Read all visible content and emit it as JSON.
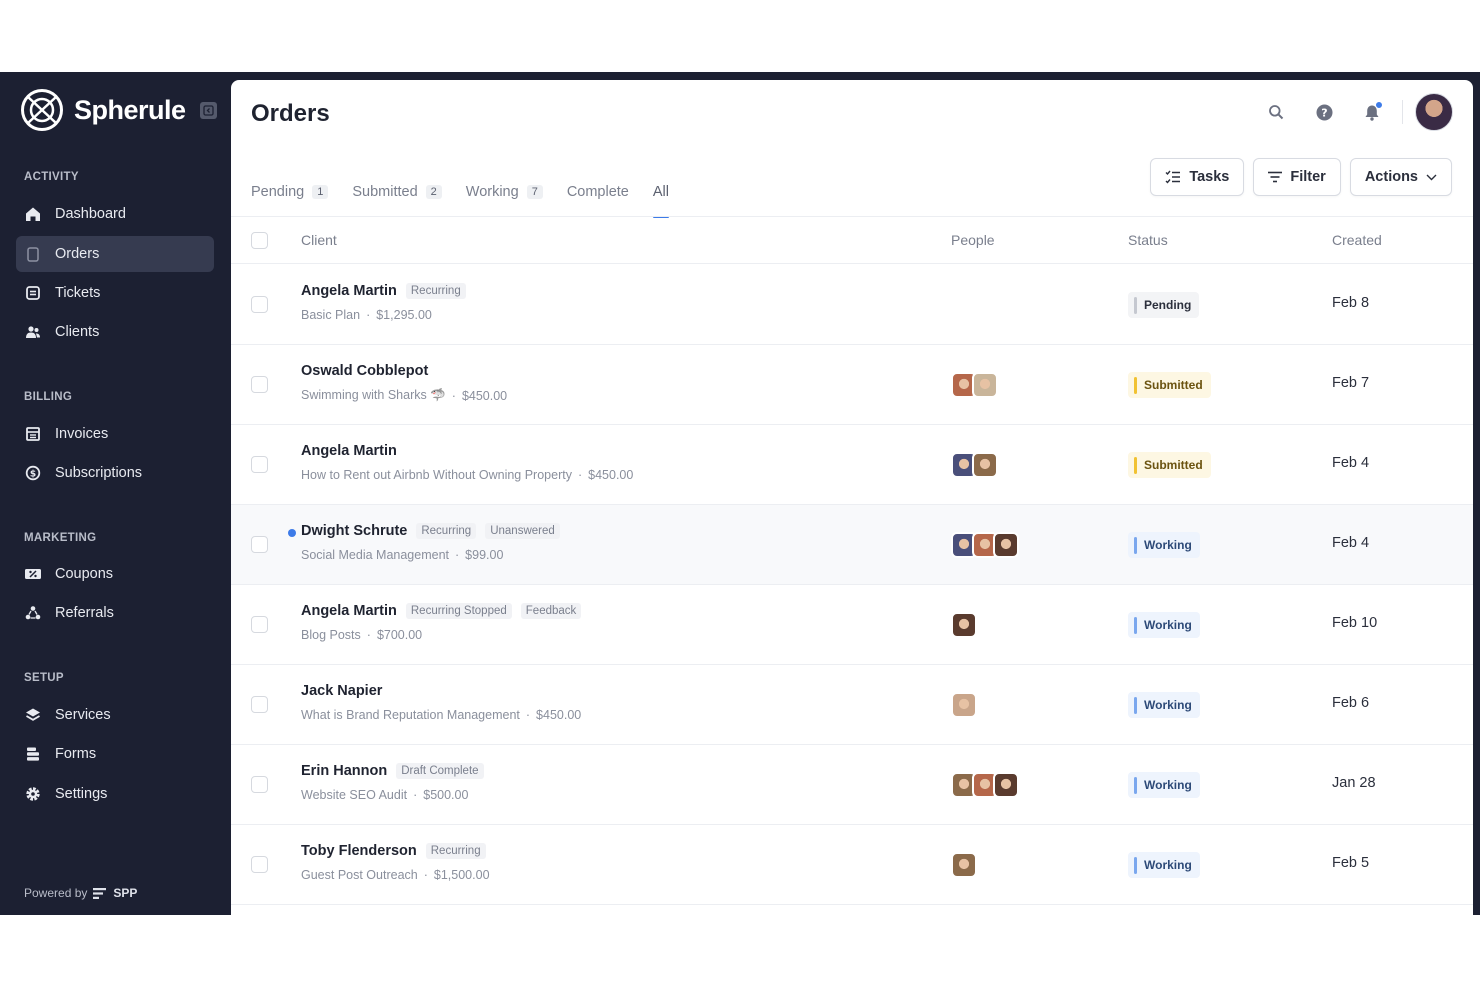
{
  "app": {
    "name": "Spherule",
    "powered_by_label": "Powered by",
    "powered_by_brand": "SPP"
  },
  "sidebar": {
    "sections": [
      {
        "label": "ACTIVITY",
        "items": [
          {
            "label": "Dashboard",
            "icon": "home-icon"
          },
          {
            "label": "Orders",
            "icon": "clipboard-icon",
            "active": true
          },
          {
            "label": "Tickets",
            "icon": "ticket-icon"
          },
          {
            "label": "Clients",
            "icon": "users-icon"
          }
        ]
      },
      {
        "label": "BILLING",
        "items": [
          {
            "label": "Invoices",
            "icon": "invoice-icon"
          },
          {
            "label": "Subscriptions",
            "icon": "subscription-icon"
          }
        ]
      },
      {
        "label": "MARKETING",
        "items": [
          {
            "label": "Coupons",
            "icon": "coupon-icon"
          },
          {
            "label": "Referrals",
            "icon": "referral-icon"
          }
        ]
      },
      {
        "label": "SETUP",
        "items": [
          {
            "label": "Services",
            "icon": "layers-icon"
          },
          {
            "label": "Forms",
            "icon": "forms-icon"
          },
          {
            "label": "Settings",
            "icon": "gear-icon"
          }
        ]
      }
    ]
  },
  "header": {
    "title": "Orders"
  },
  "tabs": [
    {
      "label": "Pending",
      "count": "1"
    },
    {
      "label": "Submitted",
      "count": "2"
    },
    {
      "label": "Working",
      "count": "7"
    },
    {
      "label": "Complete",
      "count": ""
    },
    {
      "label": "All",
      "count": "",
      "active": true
    }
  ],
  "toolbar": {
    "tasks_label": "Tasks",
    "filter_label": "Filter",
    "actions_label": "Actions"
  },
  "table": {
    "columns": {
      "client": "Client",
      "people": "People",
      "status": "Status",
      "created": "Created"
    },
    "rows": [
      {
        "client": "Angela Martin",
        "tags": [
          "Recurring"
        ],
        "service": "Basic Plan",
        "price": "$1,295.00",
        "people": [],
        "status": "Pending",
        "status_kind": "pending",
        "created": "Feb 8"
      },
      {
        "client": "Oswald Cobblepot",
        "tags": [],
        "service": "Swimming with Sharks 🦈",
        "price": "$450.00",
        "people": [
          "#b5674a",
          "#c9b59a"
        ],
        "status": "Submitted",
        "status_kind": "submitted",
        "created": "Feb 7"
      },
      {
        "client": "Angela Martin",
        "tags": [],
        "service": "How to Rent out Airbnb Without Owning Property",
        "price": "$450.00",
        "people": [
          "#4a4f7a",
          "#8b6a4a"
        ],
        "status": "Submitted",
        "status_kind": "submitted",
        "created": "Feb 4"
      },
      {
        "client": "Dwight Schrute",
        "tags": [
          "Recurring",
          "Unanswered"
        ],
        "service": "Social Media Management",
        "price": "$99.00",
        "people": [
          "#4a4f7a",
          "#b5674a",
          "#5a3b2e"
        ],
        "status": "Working",
        "status_kind": "working",
        "created": "Feb 4",
        "unread": true
      },
      {
        "client": "Angela Martin",
        "tags": [
          "Recurring Stopped",
          "Feedback"
        ],
        "service": "Blog Posts",
        "price": "$700.00",
        "people": [
          "#5a3b2e"
        ],
        "status": "Working",
        "status_kind": "working",
        "created": "Feb 10"
      },
      {
        "client": "Jack Napier",
        "tags": [],
        "service": "What is Brand Reputation Management",
        "price": "$450.00",
        "people": [
          "#c9a58a"
        ],
        "status": "Working",
        "status_kind": "working",
        "created": "Feb 6"
      },
      {
        "client": "Erin Hannon",
        "tags": [
          "Draft Complete"
        ],
        "service": "Website SEO Audit",
        "price": "$500.00",
        "people": [
          "#8b6a4a",
          "#b5674a",
          "#5a3b2e"
        ],
        "status": "Working",
        "status_kind": "working",
        "created": "Jan 28"
      },
      {
        "client": "Toby Flenderson",
        "tags": [
          "Recurring"
        ],
        "service": "Guest Post Outreach",
        "price": "$1,500.00",
        "people": [
          "#8b6a4a"
        ],
        "status": "Working",
        "status_kind": "working",
        "created": "Feb 5"
      }
    ]
  },
  "colors": {
    "sidebar_bg": "#1c2032",
    "accent": "#3d7be8",
    "submitted": "#f1c232",
    "working": "#7aa7ee"
  }
}
